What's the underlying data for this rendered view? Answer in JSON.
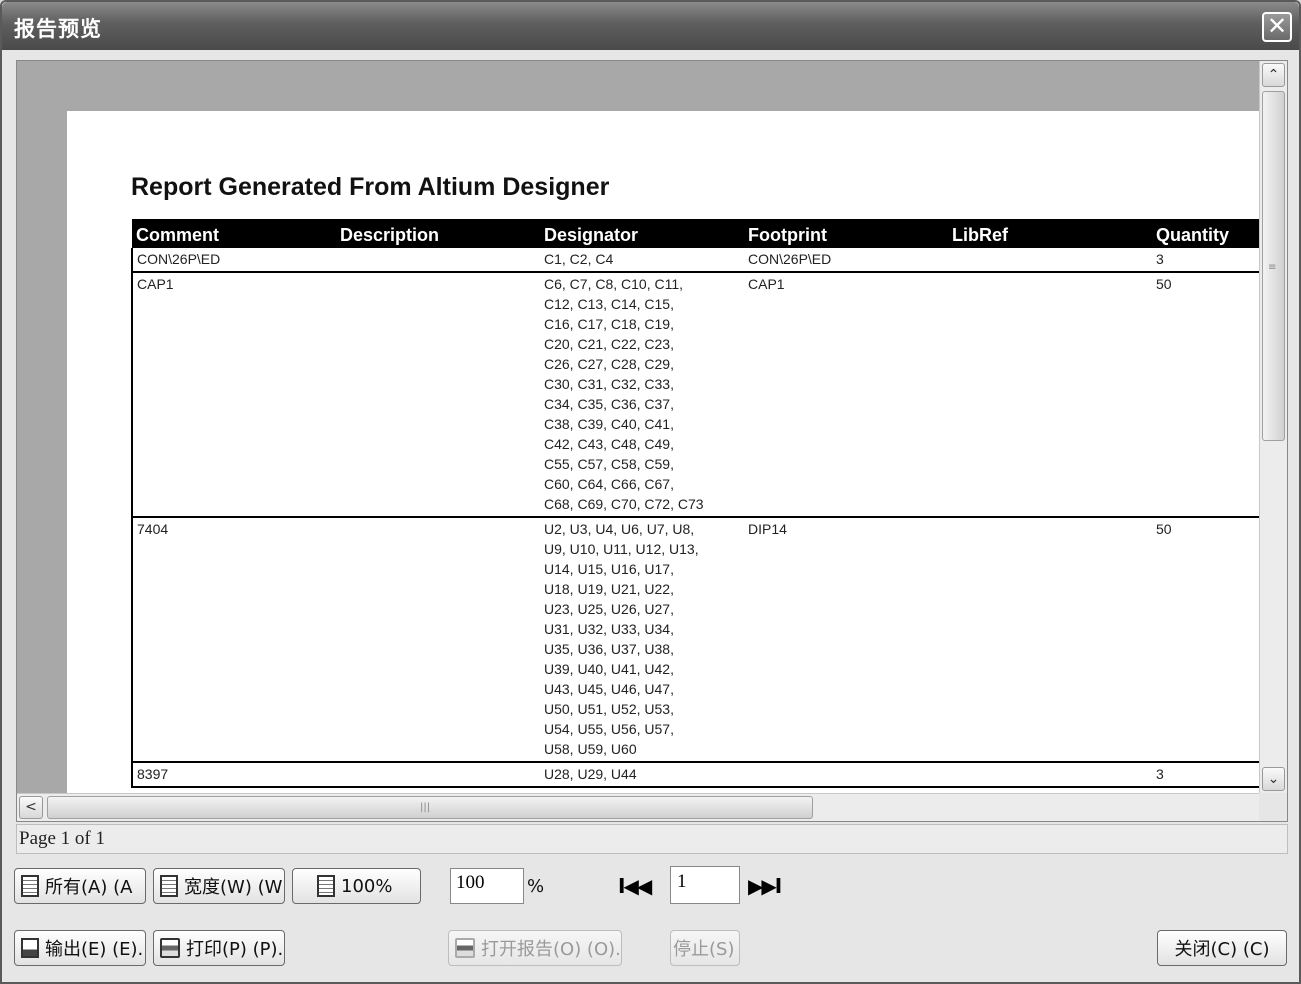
{
  "window": {
    "title": "报告预览",
    "close_glyph": "✕"
  },
  "report": {
    "title": "Report Generated From Altium Designer",
    "columns": [
      "Comment",
      "Description",
      "Designator",
      "Footprint",
      "LibRef",
      "Quantity"
    ],
    "rows": [
      {
        "comment": "CON\\26P\\ED",
        "description": "",
        "designator": [
          "C1, C2, C4"
        ],
        "footprint": "CON\\26P\\ED",
        "libref": "",
        "quantity": "3"
      },
      {
        "comment": "CAP1",
        "description": "",
        "designator": [
          "C6, C7, C8, C10, C11,",
          "C12, C13, C14, C15,",
          "C16, C17, C18, C19,",
          "C20, C21, C22, C23,",
          "C26, C27, C28, C29,",
          "C30, C31, C32, C33,",
          "C34, C35, C36, C37,",
          "C38, C39, C40, C41,",
          "C42, C43, C48, C49,",
          "C55, C57, C58, C59,",
          "C60, C64, C66, C67,",
          "C68, C69, C70, C72, C73"
        ],
        "footprint": "CAP1",
        "libref": "",
        "quantity": "50"
      },
      {
        "comment": "7404",
        "description": "",
        "designator": [
          "U2, U3, U4, U6, U7, U8,",
          "U9, U10, U11, U12, U13,",
          "U14, U15, U16, U17,",
          "U18, U19, U21, U22,",
          "U23, U25, U26, U27,",
          "U31, U32, U33, U34,",
          "U35, U36, U37, U38,",
          "U39, U40, U41, U42,",
          "U43, U45, U46, U47,",
          "U50, U51, U52, U53,",
          "U54, U55, U56, U57,",
          "U58, U59, U60"
        ],
        "footprint": "DIP14",
        "libref": "",
        "quantity": "50"
      },
      {
        "comment": "8397",
        "description": "",
        "designator": [
          "U28, U29, U44"
        ],
        "footprint": "",
        "libref": "",
        "quantity": "3"
      }
    ]
  },
  "scroll": {
    "up": "⌃",
    "down": "⌄",
    "left": "<",
    "right": ">",
    "grip": "|||",
    "vgrip": "≡"
  },
  "status": {
    "page_text": "Page 1 of 1"
  },
  "toolbar": {
    "all_label": "所有(A) (A",
    "width_label": "宽度(W) (W",
    "zoom100_label": "100%",
    "zoom_value": "100",
    "pct_sign": "%",
    "nav_first": "I◀◀",
    "nav_last": "▶▶I",
    "page_value": "1",
    "export_label": "输出(E) (E)..",
    "print_label": "打印(P) (P)..",
    "open_report_label": "打开报告(O) (O)..",
    "stop_label": "停止(S) (",
    "close_label": "关闭(C) (C)"
  }
}
